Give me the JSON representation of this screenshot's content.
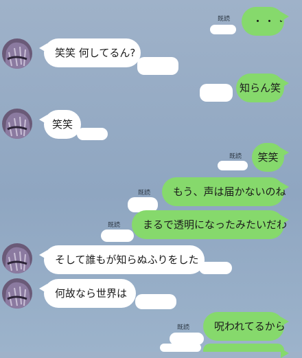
{
  "read_label": "既読",
  "messages": [
    {
      "side": "out",
      "text": "・・・"
    },
    {
      "side": "in",
      "text": "笑笑 何してるん?"
    },
    {
      "side": "out",
      "text": "知らん笑"
    },
    {
      "side": "in",
      "text": "笑笑"
    },
    {
      "side": "out",
      "text": "笑笑"
    },
    {
      "side": "out",
      "text": "もう、声は届かないのね"
    },
    {
      "side": "out",
      "text": "まるで透明になったみたいだわ"
    },
    {
      "side": "in",
      "text": "そして誰もが知らぬふりをした"
    },
    {
      "side": "in",
      "text": "何故なら世界は"
    },
    {
      "side": "out",
      "text": "呪われてるから"
    }
  ],
  "icons": {
    "avatar": "user-avatar"
  }
}
